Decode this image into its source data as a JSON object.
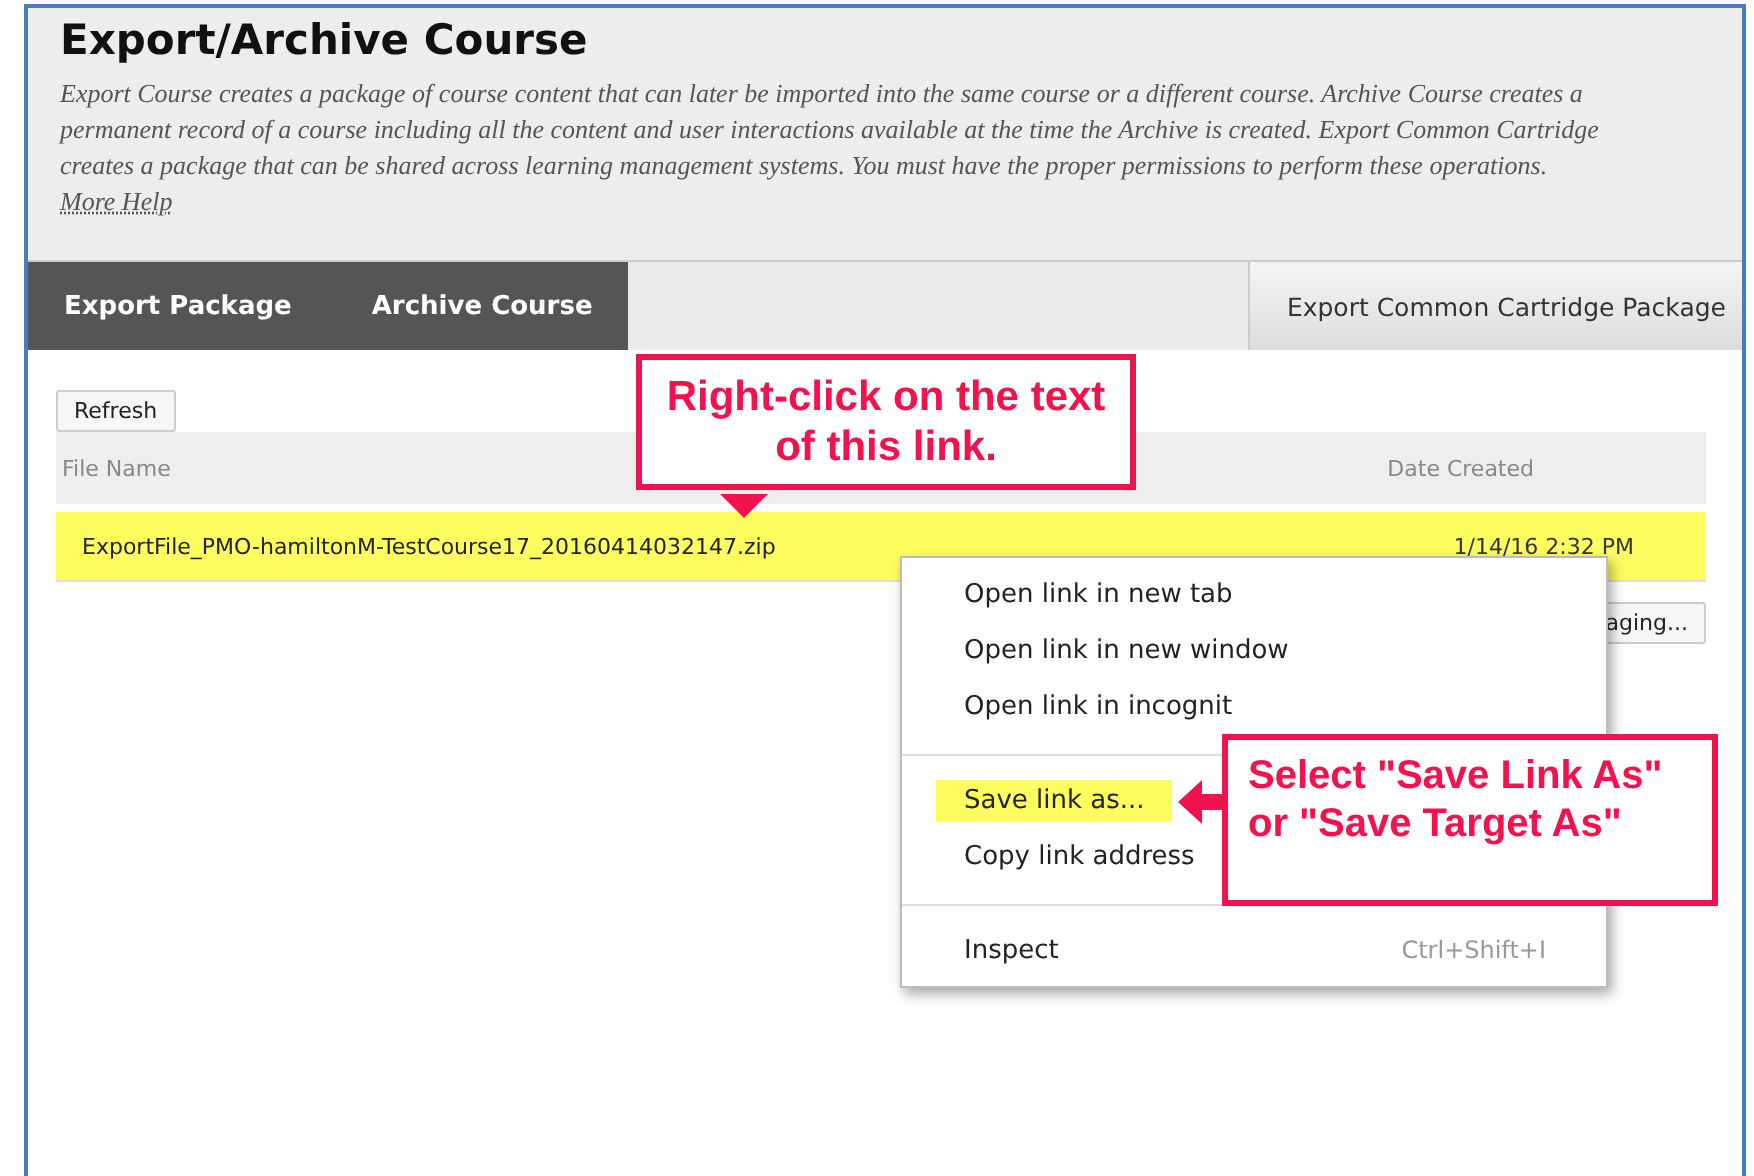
{
  "page": {
    "title": "Export/Archive Course",
    "description": "Export Course creates a package of course content that can later be imported into the same course or a different course. Archive Course creates a permanent record of a course including all the content and user interactions available at the time the Archive is created. Export Common Cartridge creates a package that can be shared across learning management systems. You must have the proper permissions to perform these operations.",
    "help_link": "More Help"
  },
  "tabs": [
    {
      "label": "Export Package",
      "kind": "dark"
    },
    {
      "label": "Archive Course",
      "kind": "dark"
    },
    {
      "label": "Export Common Cartridge Package",
      "kind": "light"
    }
  ],
  "refresh_button": "Refresh",
  "table": {
    "columns": [
      "File Name",
      "Date Created"
    ],
    "rows": [
      {
        "file": "ExportFile_PMO-hamiltonM-TestCourse17_20160414032147.zip",
        "date": "1/14/16 2:32 PM",
        "highlighted": true
      }
    ]
  },
  "partial_button": "aging...",
  "context_menu": {
    "items": [
      {
        "label": "Open link in new tab",
        "kind": "item",
        "selected": false
      },
      {
        "label": "Open link in new window",
        "kind": "item",
        "selected": false
      },
      {
        "label": "Open link in incognit",
        "kind": "item",
        "selected": false
      },
      {
        "kind": "separator"
      },
      {
        "label": "Save link as...",
        "kind": "item",
        "selected": true
      },
      {
        "label": "Copy link address",
        "kind": "item",
        "selected": false
      },
      {
        "kind": "separator"
      },
      {
        "label": "Inspect",
        "shortcut": "Ctrl+Shift+I",
        "kind": "item",
        "selected": false
      }
    ]
  },
  "callouts": [
    {
      "text": "Right-click on the text of this link.",
      "kind": "pointer-down"
    },
    {
      "text": "Select \"Save Link As\" or \"Save Target As\"",
      "kind": "arrow-left"
    }
  ]
}
